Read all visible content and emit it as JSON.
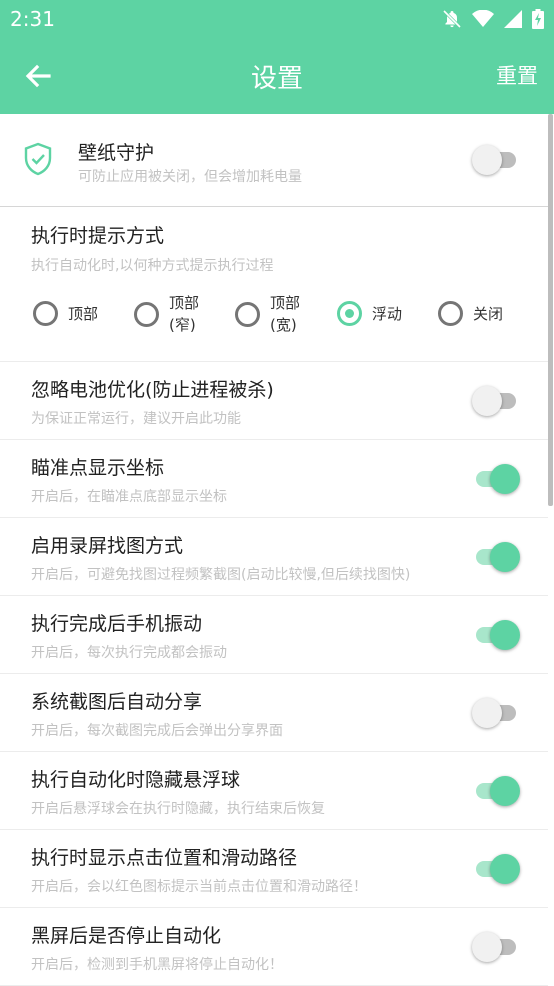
{
  "status": {
    "time": "2:31"
  },
  "appbar": {
    "title": "设置",
    "reset_label": "重置"
  },
  "guard": {
    "title": "壁纸守护",
    "subtitle": "可防止应用被关闭，但会增加耗电量",
    "enabled": false
  },
  "notify": {
    "title": "执行时提示方式",
    "subtitle": "执行自动化时,以何种方式提示执行过程",
    "options": [
      {
        "line1": "顶部",
        "line2": ""
      },
      {
        "line1": "顶部",
        "line2": "(窄)"
      },
      {
        "line1": "顶部",
        "line2": "(宽)"
      },
      {
        "line1": "浮动",
        "line2": ""
      },
      {
        "line1": "关闭",
        "line2": ""
      }
    ],
    "selected_index": 3
  },
  "settings": [
    {
      "title": "忽略电池优化(防止进程被杀)",
      "subtitle": "为保证正常运行，建议开启此功能",
      "enabled": false
    },
    {
      "title": "瞄准点显示坐标",
      "subtitle": "开启后，在瞄准点底部显示坐标",
      "enabled": true
    },
    {
      "title": "启用录屏找图方式",
      "subtitle": "开启后，可避免找图过程频繁截图(启动比较慢,但后续找图快)",
      "enabled": true
    },
    {
      "title": "执行完成后手机振动",
      "subtitle": "开启后，每次执行完成都会振动",
      "enabled": true
    },
    {
      "title": "系统截图后自动分享",
      "subtitle": "开启后，每次截图完成后会弹出分享界面",
      "enabled": false
    },
    {
      "title": "执行自动化时隐藏悬浮球",
      "subtitle": "开启后悬浮球会在执行时隐藏，执行结束后恢复",
      "enabled": true
    },
    {
      "title": "执行时显示点击位置和滑动路径",
      "subtitle": "开启后，会以红色图标提示当前点击位置和滑动路径！",
      "enabled": true
    },
    {
      "title": "黑屏后是否停止自动化",
      "subtitle": "开启后，检测到手机黑屏将停止自动化！",
      "enabled": false
    }
  ]
}
